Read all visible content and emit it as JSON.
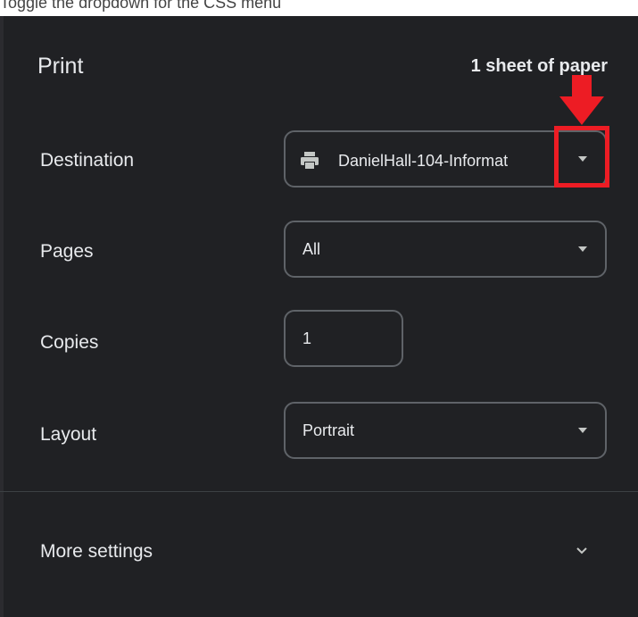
{
  "caption_crop": "Toggle the dropdown for the CSS menu",
  "print": {
    "title": "Print",
    "summary": "1 sheet of paper"
  },
  "destination": {
    "label": "Destination",
    "value": "DanielHall-104-Informat",
    "icon": "printer-icon"
  },
  "pages": {
    "label": "Pages",
    "value": "All"
  },
  "copies": {
    "label": "Copies",
    "value": "1"
  },
  "layout": {
    "label": "Layout",
    "value": "Portrait"
  },
  "more_settings": {
    "label": "More settings"
  },
  "colors": {
    "panel_bg": "#202124",
    "annotation_red": "#ED1C24"
  }
}
